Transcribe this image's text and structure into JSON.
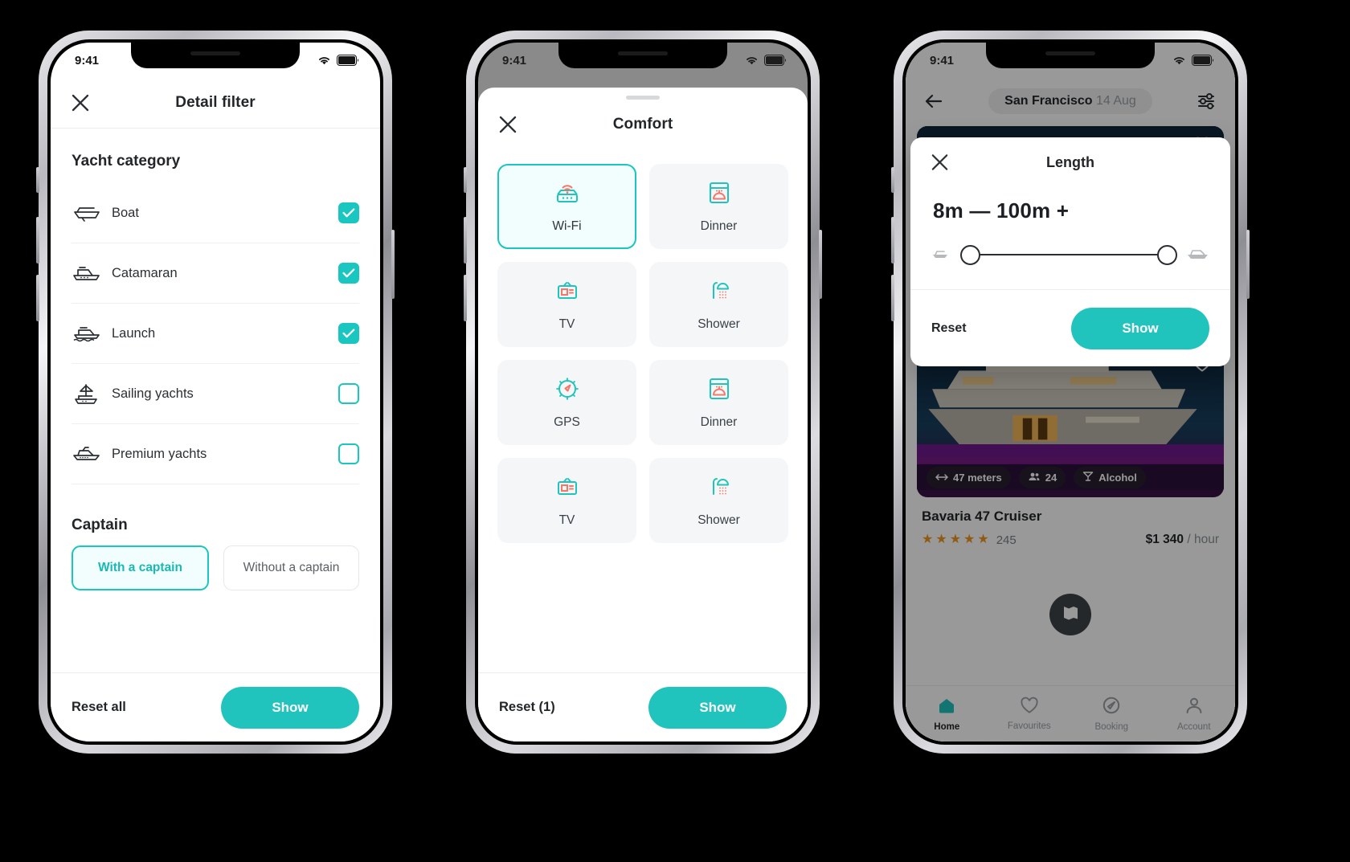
{
  "accent": "#21c4bd",
  "accent_dark": "#19b9b4",
  "coral": "#f4776a",
  "star_color": "#f0961e",
  "status": {
    "time": "9:41",
    "wifi_icon": "wifi-icon",
    "battery_icon": "battery-icon"
  },
  "phone1": {
    "header": {
      "title": "Detail filter",
      "close_icon": "close-icon"
    },
    "section_title": "Yacht category",
    "categories": [
      {
        "label": "Boat",
        "icon": "boat-icon",
        "checked": true
      },
      {
        "label": "Catamaran",
        "icon": "catamaran-icon",
        "checked": true
      },
      {
        "label": "Launch",
        "icon": "launch-icon",
        "checked": true
      },
      {
        "label": "Sailing yachts",
        "icon": "sailing-yacht-icon",
        "checked": false
      },
      {
        "label": "Premium yachts",
        "icon": "premium-yacht-icon",
        "checked": false
      }
    ],
    "captain": {
      "title": "Captain",
      "options": [
        {
          "label": "With a captain",
          "active": true
        },
        {
          "label": "Without a captain",
          "active": false
        }
      ]
    },
    "footer": {
      "reset_label": "Reset all",
      "show_label": "Show"
    }
  },
  "phone2": {
    "header": {
      "title": "Comfort",
      "close_icon": "close-icon"
    },
    "tiles": [
      {
        "label": "Wi-Fi",
        "icon": "wifi-router-icon",
        "selected": true
      },
      {
        "label": "Dinner",
        "icon": "dinner-icon",
        "selected": false
      },
      {
        "label": "TV",
        "icon": "tv-icon",
        "selected": false
      },
      {
        "label": "Shower",
        "icon": "shower-icon",
        "selected": false
      },
      {
        "label": "GPS",
        "icon": "compass-icon",
        "selected": false
      },
      {
        "label": "Dinner",
        "icon": "dinner-icon",
        "selected": false
      },
      {
        "label": "TV",
        "icon": "tv-icon",
        "selected": false
      },
      {
        "label": "Shower",
        "icon": "shower-icon",
        "selected": false
      }
    ],
    "footer": {
      "reset_label": "Reset (1)",
      "show_label": "Show"
    }
  },
  "phone3": {
    "topbar": {
      "back_icon": "back-arrow-icon",
      "location": "San Francisco",
      "date": "14 Aug",
      "filter_icon": "filter-sliders-icon"
    },
    "modal": {
      "close_icon": "close-icon",
      "title": "Length",
      "range_label": "8m — 100m +",
      "min_icon": "small-boat-icon",
      "max_icon": "large-yacht-icon",
      "reset_label": "Reset",
      "show_label": "Show"
    },
    "cards": [
      {
        "title": "Bavaria 47 Cruiser",
        "rating_stars": 5,
        "reviews": "245",
        "price": "$1 340",
        "price_unit": "/ hour",
        "favourite_icon": "heart-icon",
        "badges": []
      },
      {
        "title": "Bavaria 47 Cruiser",
        "rating_stars": 5,
        "reviews": "245",
        "price": "$1 340",
        "price_unit": "/ hour",
        "favourite_icon": "heart-icon",
        "badges": [
          {
            "icon": "length-arrows-icon",
            "label": "47 meters"
          },
          {
            "icon": "people-icon",
            "label": "24"
          },
          {
            "icon": "cocktail-icon",
            "label": "Alcohol"
          }
        ]
      }
    ],
    "map_fab_icon": "map-icon",
    "tabs": [
      {
        "label": "Home",
        "icon": "home-icon",
        "active": true
      },
      {
        "label": "Favourites",
        "icon": "heart-icon",
        "active": false
      },
      {
        "label": "Booking",
        "icon": "compass-icon",
        "active": false
      },
      {
        "label": "Account",
        "icon": "person-icon",
        "active": false
      }
    ]
  }
}
